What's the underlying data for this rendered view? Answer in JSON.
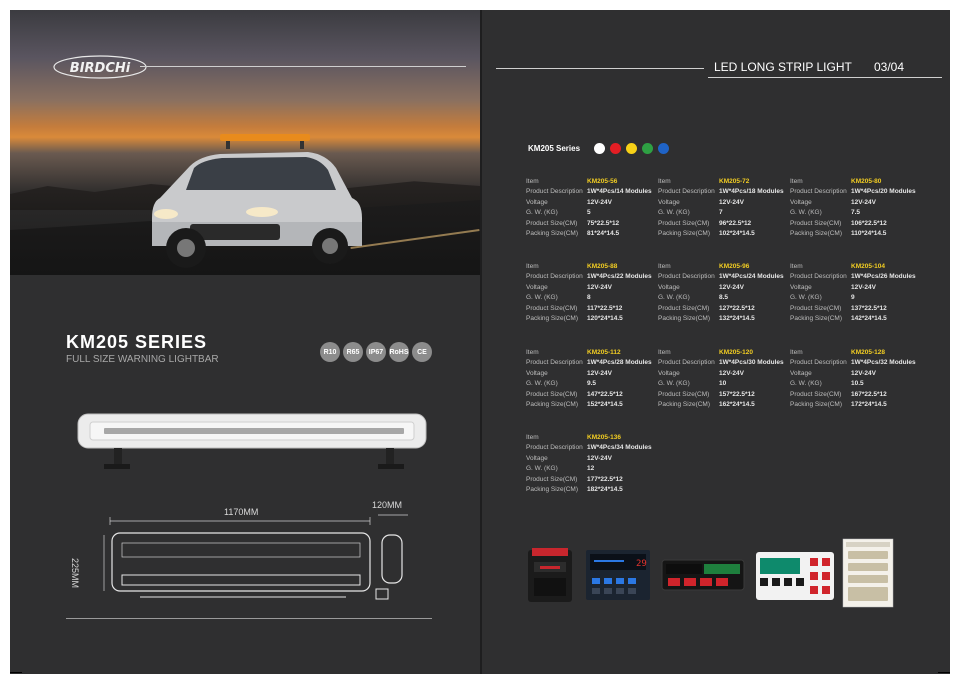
{
  "left_page": {
    "brand": "BIRDCHi",
    "series_title": "KM205 SERIES",
    "series_subtitle": "FULL SIZE WARNING LIGHTBAR",
    "certifications": [
      "R10",
      "R65",
      "IP67",
      "RoHS",
      "CE"
    ],
    "dimensions": {
      "length": "1170MM",
      "width": "120MM",
      "height": "225MM"
    }
  },
  "right_page": {
    "header": {
      "title": "LED LONG STRIP LIGHT",
      "page": "03/04"
    },
    "series_label": "KM205 Series",
    "color_options": [
      "#ffffff",
      "#e31e24",
      "#f7d117",
      "#2ea043",
      "#1f63c6"
    ],
    "labels": {
      "item": "Item",
      "description": "Product Description",
      "voltage": "Voltage",
      "weight": "G. W. (KG)",
      "size": "Product Size(CM)",
      "packing": "Packing Size(CM)"
    },
    "products": [
      {
        "item": "KM205-56",
        "description": "1W*4Pcs/14 Modules",
        "voltage": "12V-24V",
        "weight": "5",
        "size": "75*22.5*12",
        "packing": "81*24*14.5"
      },
      {
        "item": "KM205-72",
        "description": "1W*4Pcs/18 Modules",
        "voltage": "12V-24V",
        "weight": "7",
        "size": "96*22.5*12",
        "packing": "102*24*14.5"
      },
      {
        "item": "KM205-80",
        "description": "1W*4Pcs/20 Modules",
        "voltage": "12V-24V",
        "weight": "7.5",
        "size": "106*22.5*12",
        "packing": "110*24*14.5"
      },
      {
        "item": "KM205-88",
        "description": "1W*4Pcs/22 Modules",
        "voltage": "12V-24V",
        "weight": "8",
        "size": "117*22.5*12",
        "packing": "120*24*14.5"
      },
      {
        "item": "KM205-96",
        "description": "1W*4Pcs/24 Modules",
        "voltage": "12V-24V",
        "weight": "8.5",
        "size": "127*22.5*12",
        "packing": "132*24*14.5"
      },
      {
        "item": "KM205-104",
        "description": "1W*4Pcs/26 Modules",
        "voltage": "12V-24V",
        "weight": "9",
        "size": "137*22.5*12",
        "packing": "142*24*14.5"
      },
      {
        "item": "KM205-112",
        "description": "1W*4Pcs/28 Modules",
        "voltage": "12V-24V",
        "weight": "9.5",
        "size": "147*22.5*12",
        "packing": "152*24*14.5"
      },
      {
        "item": "KM205-120",
        "description": "1W*4Pcs/30 Modules",
        "voltage": "12V-24V",
        "weight": "10",
        "size": "157*22.5*12",
        "packing": "162*24*14.5"
      },
      {
        "item": "KM205-128",
        "description": "1W*4Pcs/32 Modules",
        "voltage": "12V-24V",
        "weight": "10.5",
        "size": "167*22.5*12",
        "packing": "172*24*14.5"
      },
      {
        "item": "KM205-136",
        "description": "1W*4Pcs/34 Modules",
        "voltage": "12V-24V",
        "weight": "12",
        "size": "177*22.5*12",
        "packing": "182*24*14.5"
      }
    ],
    "controller_readout": "29"
  }
}
